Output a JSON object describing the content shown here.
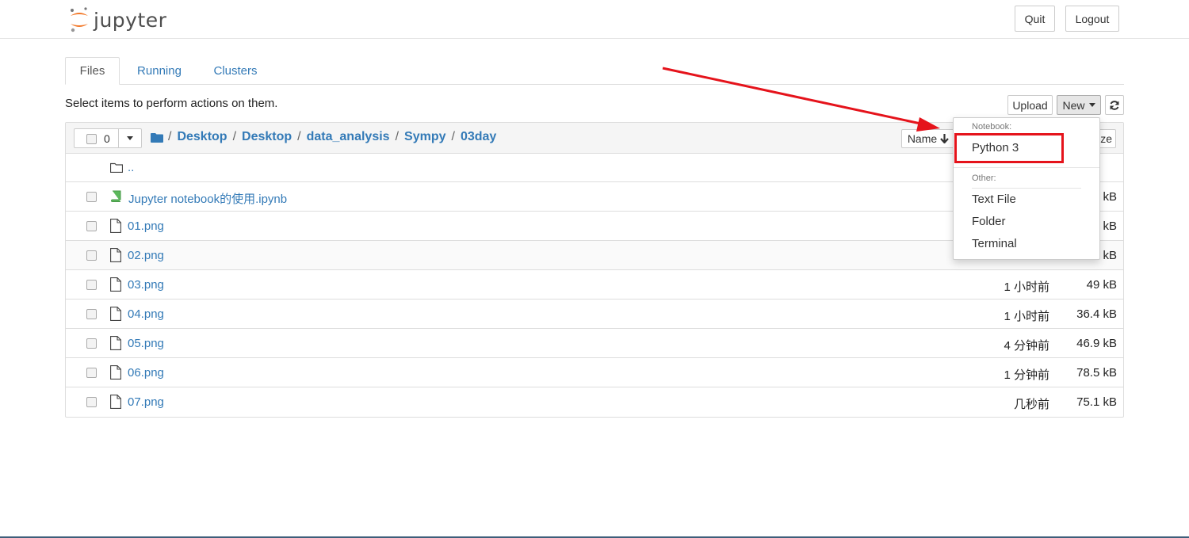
{
  "header": {
    "logo_text": "jupyter",
    "quit_label": "Quit",
    "logout_label": "Logout"
  },
  "tabs": [
    {
      "label": "Files"
    },
    {
      "label": "Running"
    },
    {
      "label": "Clusters"
    }
  ],
  "hint": "Select items to perform actions on them.",
  "toolbar": {
    "upload_label": "Upload",
    "new_label": "New"
  },
  "selection": {
    "count": "0"
  },
  "breadcrumb": {
    "sep": "/",
    "items": [
      "Desktop",
      "Desktop",
      "data_analysis",
      "Sympy",
      "03day"
    ]
  },
  "sort": {
    "name_label": "Name",
    "size_label": "ze"
  },
  "parent_dir": "..",
  "files": [
    {
      "name": "Jupyter notebook的使用.ipynb",
      "type": "notebook",
      "time": "",
      "size": "kB"
    },
    {
      "name": "01.png",
      "type": "file",
      "time": "",
      "size": "kB"
    },
    {
      "name": "02.png",
      "type": "file",
      "time": "",
      "size": "kB"
    },
    {
      "name": "03.png",
      "type": "file",
      "time": "1 小时前",
      "size": "49 kB"
    },
    {
      "name": "04.png",
      "type": "file",
      "time": "1 小时前",
      "size": "36.4 kB"
    },
    {
      "name": "05.png",
      "type": "file",
      "time": "4 分钟前",
      "size": "46.9 kB"
    },
    {
      "name": "06.png",
      "type": "file",
      "time": "1 分钟前",
      "size": "78.5 kB"
    },
    {
      "name": "07.png",
      "type": "file",
      "time": "几秒前",
      "size": "75.1 kB"
    }
  ],
  "menu": {
    "notebook_header": "Notebook:",
    "python3": "Python 3",
    "other_header": "Other:",
    "text_file": "Text File",
    "folder": "Folder",
    "terminal": "Terminal"
  },
  "colors": {
    "link": "#337ab7",
    "annotation": "#e5131b",
    "logo_orange": "#f37726"
  }
}
